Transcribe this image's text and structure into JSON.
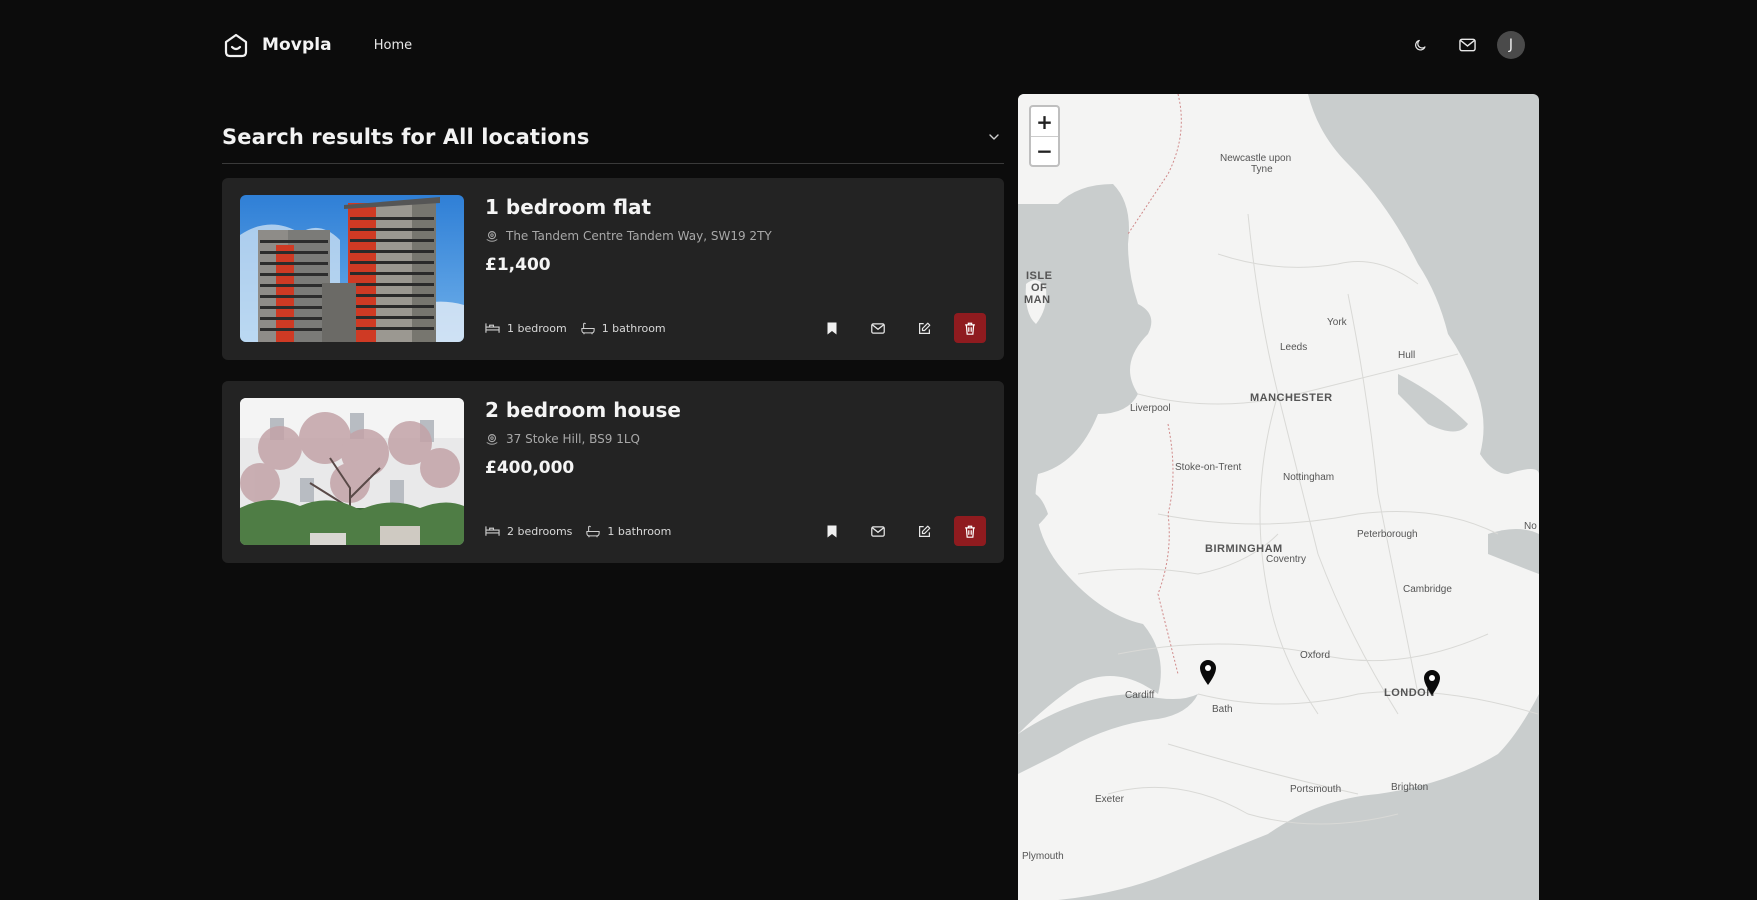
{
  "header": {
    "brand": "Movpla",
    "nav_home": "Home",
    "avatar_initial": "J"
  },
  "results": {
    "title": "Search results for All locations"
  },
  "listings": [
    {
      "title": "1 bedroom flat",
      "address": "The Tandem Centre Tandem Way, SW19 2TY",
      "price": "£1,400",
      "bedrooms": "1 bedroom",
      "bathrooms": "1 bathroom"
    },
    {
      "title": "2 bedroom house",
      "address": "37 Stoke Hill, BS9 1LQ",
      "price": "£400,000",
      "bedrooms": "2 bedrooms",
      "bathrooms": "1 bathroom"
    }
  ],
  "map": {
    "zoom_in": "+",
    "zoom_out": "−",
    "labels": {
      "newcastle": "Newcastle upon",
      "tyne": "Tyne",
      "isle": "ISLE",
      "of": "OF",
      "man": "MAN",
      "york": "York",
      "leeds": "Leeds",
      "hull": "Hull",
      "liverpool": "Liverpool",
      "manchester": "MANCHESTER",
      "stoke": "Stoke-on-Trent",
      "nottingham": "Nottingham",
      "birmingham": "BIRMINGHAM",
      "coventry": "Coventry",
      "peterborough": "Peterborough",
      "cambridge": "Cambridge",
      "oxford": "Oxford",
      "cardiff": "Cardiff",
      "bath": "Bath",
      "london": "LONDON",
      "exeter": "Exeter",
      "portsmouth": "Portsmouth",
      "brighton": "Brighton",
      "plymouth": "Plymouth",
      "no": "No"
    }
  },
  "colors": {
    "background": "#0c0c0c",
    "card": "#232323",
    "danger": "#8f1b1f",
    "sea": "#c9cdcd",
    "land": "#f4f4f3"
  }
}
